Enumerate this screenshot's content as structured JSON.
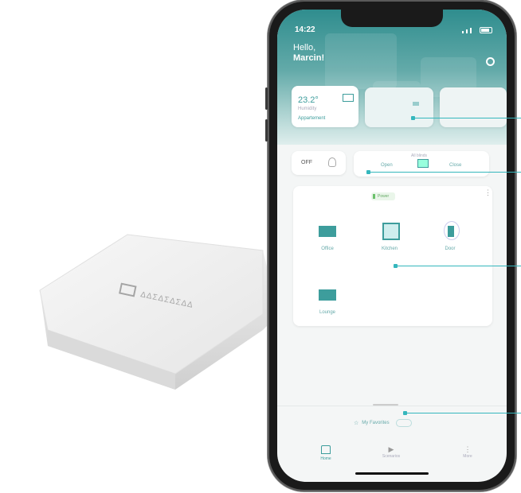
{
  "status": {
    "time": "14:22"
  },
  "greeting": {
    "hello": "Hello,",
    "name": "Marcin!"
  },
  "device_card": {
    "temperature": "23.2°",
    "sub_label": "Humidity",
    "name": "Appartement"
  },
  "light": {
    "state": "OFF"
  },
  "scene": {
    "label": "All blinds",
    "left": "Open",
    "right": "Close"
  },
  "room": {
    "battery_label": "Power",
    "devices": [
      {
        "label": "Office"
      },
      {
        "label": "Kitchen"
      },
      {
        "label": "Door"
      },
      {
        "label": "Lounge"
      }
    ]
  },
  "favorites": {
    "label": "My Favorites"
  },
  "nav": {
    "home": "Home",
    "scenarios": "Scenarios",
    "more": "More"
  },
  "colors": {
    "teal": "#2f8d8e",
    "accent_callout": "#35b7bd"
  }
}
